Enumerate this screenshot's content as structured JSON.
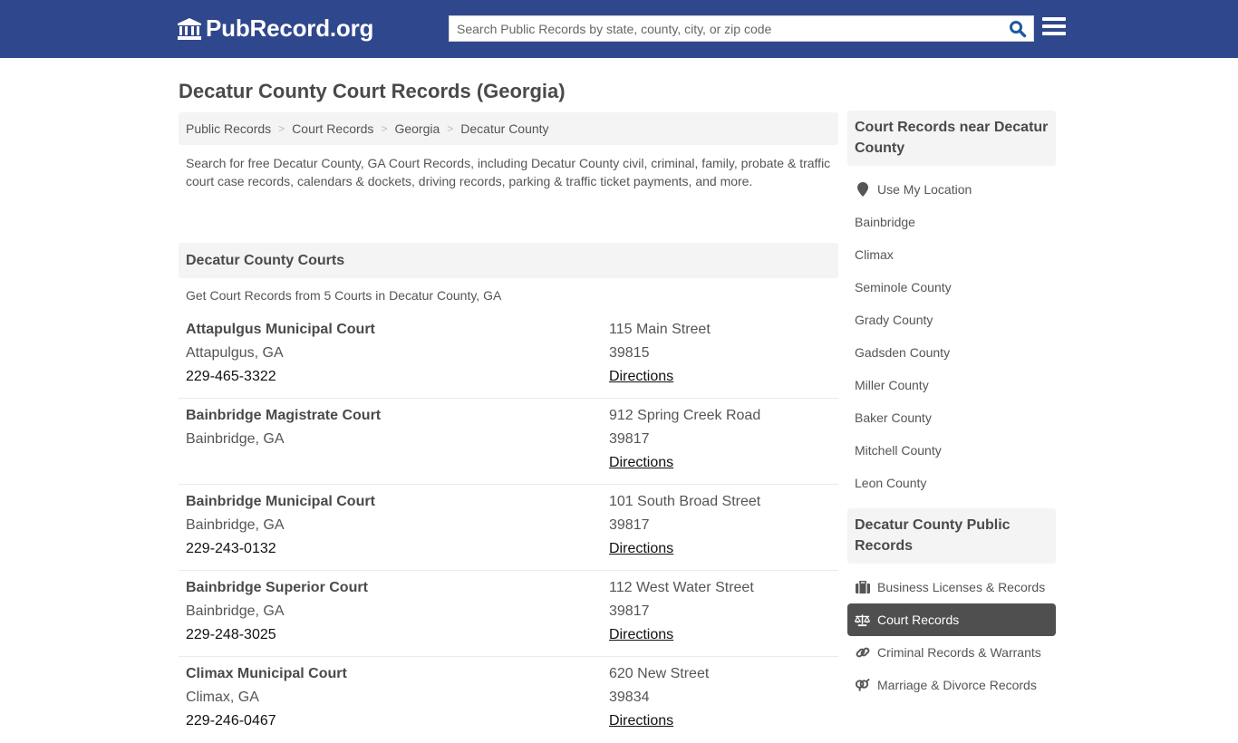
{
  "header": {
    "logo_text": "PubRecord.org",
    "search_placeholder": "Search Public Records by state, county, city, or zip code",
    "brand_color": "#2f478d",
    "search_icon_color": "#1e5aa0"
  },
  "page_title": "Decatur County Court Records (Georgia)",
  "breadcrumb": [
    {
      "label": "Public Records"
    },
    {
      "label": "Court Records"
    },
    {
      "label": "Georgia"
    },
    {
      "label": "Decatur County"
    }
  ],
  "breadcrumb_separator": ">",
  "intro": "Search for free Decatur County, GA Court Records, including Decatur County civil, criminal, family, probate & traffic court case records, calendars & dockets, driving records, parking & traffic ticket payments, and more.",
  "courts_section": {
    "title": "Decatur County Courts",
    "subtitle": "Get Court Records from 5 Courts in Decatur County, GA",
    "courts": [
      {
        "name": "Attapulgus Municipal Court",
        "city": "Attapulgus, GA",
        "phone": "229-465-3322",
        "address": "115 Main Street",
        "zip": "39815",
        "directions": "Directions"
      },
      {
        "name": "Bainbridge Magistrate Court",
        "city": "Bainbridge, GA",
        "phone": "",
        "address": "912 Spring Creek Road",
        "zip": "39817",
        "directions": "Directions"
      },
      {
        "name": "Bainbridge Municipal Court",
        "city": "Bainbridge, GA",
        "phone": "229-243-0132",
        "address": "101 South Broad Street",
        "zip": "39817",
        "directions": "Directions"
      },
      {
        "name": "Bainbridge Superior Court",
        "city": "Bainbridge, GA",
        "phone": "229-248-3025",
        "address": "112 West Water Street",
        "zip": "39817",
        "directions": "Directions"
      },
      {
        "name": "Climax Municipal Court",
        "city": "Climax, GA",
        "phone": "229-246-0467",
        "address": "620 New Street",
        "zip": "39834",
        "directions": "Directions"
      }
    ]
  },
  "sidebar": {
    "nearby_title": "Court Records near Decatur County",
    "use_location": "Use My Location",
    "nearby": [
      "Bainbridge",
      "Climax",
      "Seminole County",
      "Grady County",
      "Gadsden County",
      "Miller County",
      "Baker County",
      "Mitchell County",
      "Leon County"
    ],
    "records_title": "Decatur County Public Records",
    "records": [
      {
        "label": "Business Licenses & Records",
        "icon": "briefcase-icon",
        "active": false
      },
      {
        "label": "Court Records",
        "icon": "balance-scale-icon",
        "active": true
      },
      {
        "label": "Criminal Records & Warrants",
        "icon": "link-icon",
        "active": false
      },
      {
        "label": "Marriage & Divorce Records",
        "icon": "venus-mars-icon",
        "active": false
      }
    ]
  }
}
